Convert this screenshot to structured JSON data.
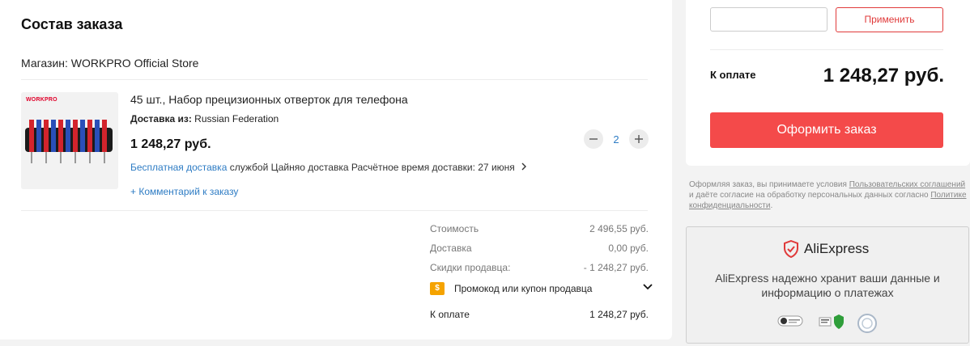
{
  "order": {
    "title": "Состав заказа",
    "store": "Магазин: WORKPRO Official Store",
    "item": {
      "brand": "WORKPRO",
      "title": "45 шт., Набор прецизионных отверток для телефона",
      "ship_from_label": "Доставка из:",
      "ship_from_value": "Russian Federation",
      "price": "1 248,27 руб.",
      "free_delivery": "Бесплатная доставка",
      "carrier": "службой Цайняо доставка",
      "eta": "Расчётное время доставки: 27 июня",
      "comment": "+ Комментарий к заказу",
      "quantity": "2"
    },
    "summary": {
      "cost_label": "Стоимость",
      "cost_value": "2 496,55 руб.",
      "delivery_label": "Доставка",
      "delivery_value": "0,00 руб.",
      "discount_label": "Скидки продавца:",
      "discount_value": "- 1 248,27 руб.",
      "promo_label": "Промокод или купон продавца",
      "total_label": "К оплате",
      "total_value": "1 248,27 руб."
    }
  },
  "checkout": {
    "coupon_placeholder": "",
    "apply_label": "Применить",
    "pay_label": "К оплате",
    "pay_value": "1 248,27 руб.",
    "order_button": "Оформить заказ",
    "terms_1": "Оформляя заказ, вы принимаете условия ",
    "terms_link1": "Пользовательских соглашений",
    "terms_2": " и даёте согласие на обработку персональных данных согласно ",
    "terms_link2": "Политике конфиденциальности",
    "terms_3": "."
  },
  "security": {
    "brand": "AliExpress",
    "text": "AliExpress надежно хранит ваши данные и информацию о платежах"
  },
  "colors": {
    "accent_red": "#f44a4a",
    "link_blue": "#2e7cc4",
    "promo_orange": "#f5a300"
  }
}
